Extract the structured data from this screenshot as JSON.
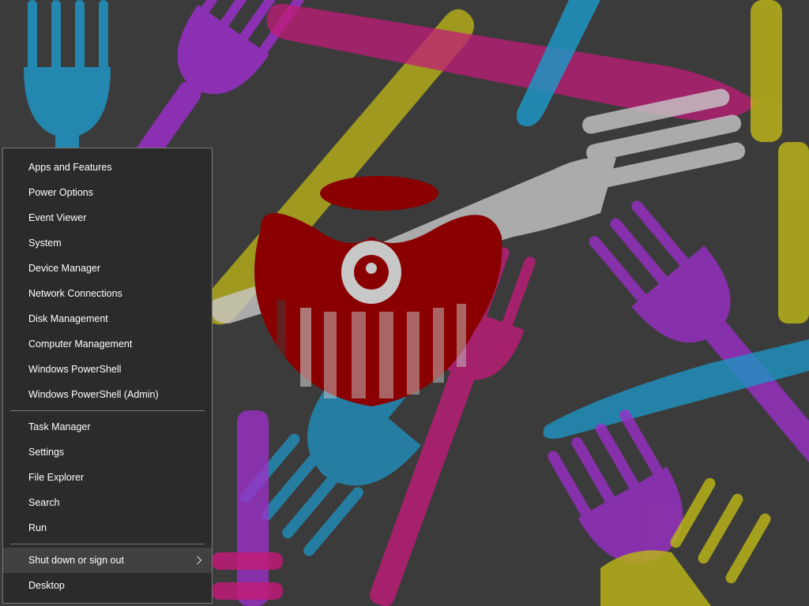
{
  "menu": {
    "group1": [
      {
        "name": "apps-and-features",
        "label": "Apps and Features"
      },
      {
        "name": "power-options",
        "label": "Power Options"
      },
      {
        "name": "event-viewer",
        "label": "Event Viewer"
      },
      {
        "name": "system",
        "label": "System"
      },
      {
        "name": "device-manager",
        "label": "Device Manager"
      },
      {
        "name": "network-connections",
        "label": "Network Connections"
      },
      {
        "name": "disk-management",
        "label": "Disk Management"
      },
      {
        "name": "computer-management",
        "label": "Computer Management"
      },
      {
        "name": "windows-powershell",
        "label": "Windows PowerShell"
      },
      {
        "name": "windows-powershell-admin",
        "label": "Windows PowerShell (Admin)"
      }
    ],
    "group2": [
      {
        "name": "task-manager",
        "label": "Task Manager"
      },
      {
        "name": "settings",
        "label": "Settings"
      },
      {
        "name": "file-explorer",
        "label": "File Explorer"
      },
      {
        "name": "search",
        "label": "Search"
      },
      {
        "name": "run",
        "label": "Run"
      }
    ],
    "group3": [
      {
        "name": "shut-down-or-sign-out",
        "label": "Shut down or sign out",
        "submenu": true,
        "highlighted": true
      },
      {
        "name": "desktop",
        "label": "Desktop"
      }
    ]
  },
  "colors": {
    "menu_background": "#2b2b2b",
    "menu_border": "#7a7a7a",
    "menu_text": "#ffffff",
    "highlight": "#414141",
    "desktop_background": "#3b3b3b",
    "fork_blue": "#1f95c4",
    "fork_purple": "#9b2fc8",
    "fork_yellow": "#b9b21a",
    "fork_pink": "#c01c78",
    "fork_white": "#c8c8c8",
    "emblem_red": "#8a0000"
  },
  "icons": {
    "submenu": "chevron-right-icon"
  }
}
